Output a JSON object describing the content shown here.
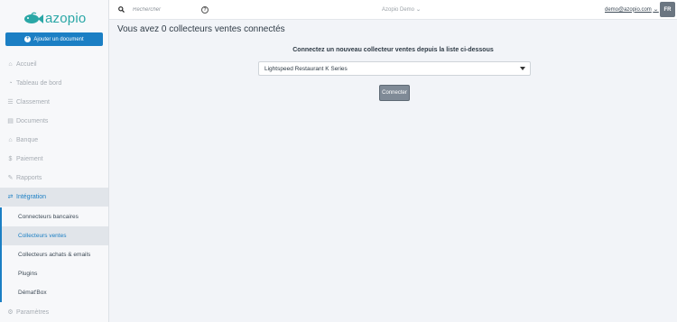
{
  "brand": {
    "name": "azopio",
    "color": "#2aa7a6"
  },
  "sidebar": {
    "add_button": "Ajouter un document",
    "items": [
      {
        "label": "Accueil",
        "icon": "home-icon"
      },
      {
        "label": "Tableau de bord",
        "icon": "dashboard-icon"
      },
      {
        "label": "Classement",
        "icon": "list-icon"
      },
      {
        "label": "Documents",
        "icon": "document-icon"
      },
      {
        "label": "Banque",
        "icon": "bank-icon"
      },
      {
        "label": "Paiement",
        "icon": "dollar-icon"
      },
      {
        "label": "Rapports",
        "icon": "edit-icon"
      },
      {
        "label": "Intégration",
        "icon": "exchange-icon",
        "active": true
      }
    ],
    "sub_items": [
      {
        "label": "Connecteurs bancaires"
      },
      {
        "label": "Collecteurs ventes",
        "active": true
      },
      {
        "label": "Collecteurs achats & emails"
      },
      {
        "label": "Plugins"
      },
      {
        "label": "Démat'Box"
      }
    ],
    "bottom_item": {
      "label": "Paramètres",
      "icon": "gear-icon"
    }
  },
  "topbar": {
    "search_placeholder": "Rechercher",
    "company": "Azopio Demo",
    "user": "demo@azopio.com",
    "lang": "FR"
  },
  "main": {
    "title": "Vous avez 0 collecteurs ventes connectés",
    "subtitle": "Connectez un nouveau collecteur ventes depuis la liste ci-dessous",
    "select_value": "Lightspeed Restaurant K Series",
    "connect_label": "Connecter"
  },
  "colors": {
    "accent": "#1b7fc4",
    "button_gray": "#7f8a96"
  }
}
